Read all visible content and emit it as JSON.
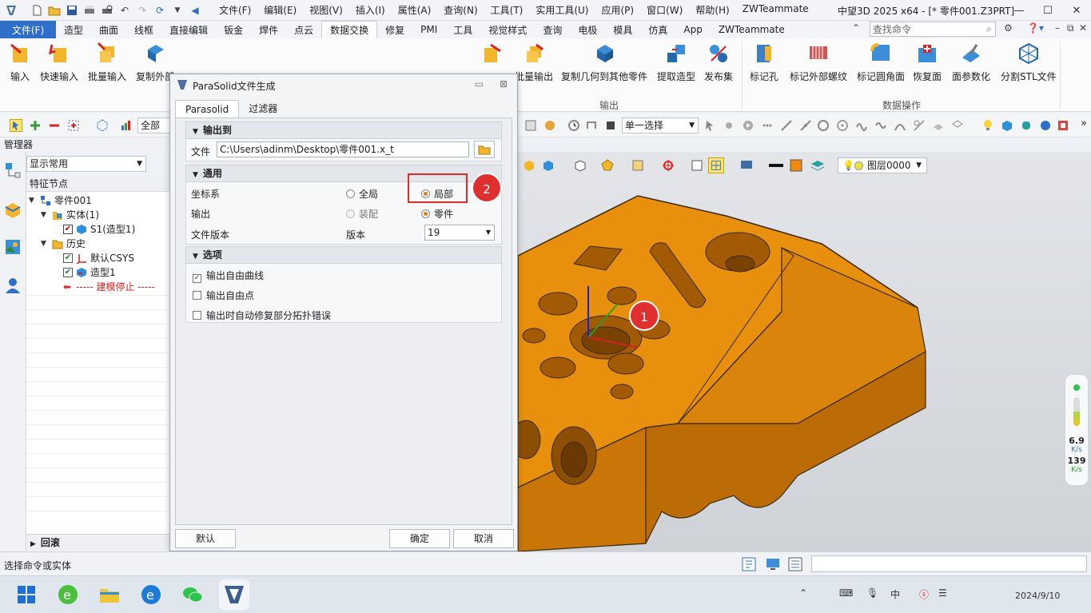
{
  "titlebar": {
    "menu": [
      "文件(F)",
      "编辑(E)",
      "视图(V)",
      "插入(I)",
      "属性(A)",
      "查询(N)",
      "工具(T)",
      "实用工具(U)",
      "应用(P)",
      "窗口(W)",
      "帮助(H)",
      "ZWTeammate"
    ],
    "app_title": "中望3D 2025 x64 - [* 零件001.Z3PRT]"
  },
  "tabs": {
    "file": "文件(F)",
    "items": [
      "造型",
      "曲面",
      "线框",
      "直接编辑",
      "钣金",
      "焊件",
      "点云",
      "数据交换",
      "修复",
      "PMI",
      "工具",
      "视觉样式",
      "查询",
      "电极",
      "模具",
      "仿真",
      "App",
      "ZWTeammate"
    ],
    "active": "数据交换",
    "search_placeholder": "查找命令"
  },
  "ribbon": {
    "buttons_left": [
      {
        "label": "输入",
        "icon": "import-icon"
      },
      {
        "label": "快速输入",
        "icon": "quick-import-icon"
      },
      {
        "label": "批量输入",
        "icon": "batch-import-icon"
      },
      {
        "label": "复制外部",
        "icon": "copy-external-icon"
      }
    ],
    "buttons_output": [
      {
        "label": "批量输出",
        "icon": "batch-export-icon"
      },
      {
        "label": "复制几何到其他零件",
        "icon": "copy-geometry-icon"
      },
      {
        "label": "提取造型",
        "icon": "extract-shape-icon"
      },
      {
        "label": "发布集",
        "icon": "publish-set-icon"
      }
    ],
    "buttons_data": [
      {
        "label": "标记孔",
        "icon": "mark-hole-icon"
      },
      {
        "label": "标记外部螺纹",
        "icon": "mark-thread-icon"
      },
      {
        "label": "标记圆角面",
        "icon": "mark-fillet-icon"
      },
      {
        "label": "恢复面",
        "icon": "restore-face-icon"
      },
      {
        "label": "面参数化",
        "icon": "face-param-icon"
      },
      {
        "label": "分割STL文件",
        "icon": "split-stl-icon"
      }
    ],
    "group_output": "输出",
    "group_data": "数据操作"
  },
  "toolbar2": {
    "filter": "全部",
    "select_mode": "单一选择"
  },
  "manager": {
    "title": "管理器",
    "combo": "显示常用",
    "tree_header": "特征节点",
    "tree": [
      {
        "label": "零件001",
        "level": 0
      },
      {
        "label": "实体(1)",
        "level": 1
      },
      {
        "label": "S1(造型1)",
        "level": 2
      },
      {
        "label": "历史",
        "level": 1
      },
      {
        "label": "默认CSYS",
        "level": 2
      },
      {
        "label": "造型1",
        "level": 2
      },
      {
        "label": "----- 建模停止 -----",
        "level": 2
      }
    ],
    "rollback": "回滚"
  },
  "viewport": {
    "layer": "图层0000"
  },
  "dialog": {
    "title": "ParaSolid文件生成",
    "tabs": [
      "Parasolid",
      "过滤器"
    ],
    "section_output": "输出到",
    "file_label": "文件",
    "file_value": "C:\\Users\\adinm\\Desktop\\零件001.x_t",
    "section_general": "通用",
    "coord_label": "坐标系",
    "coord_global": "全局",
    "coord_local": "局部",
    "output_label": "输出",
    "output_assembly": "装配",
    "output_part": "零件",
    "version_label": "文件版本",
    "version_label2": "版本",
    "version_value": "19",
    "section_options": "选项",
    "opt1": "输出自由曲线",
    "opt2": "输出自由点",
    "opt3": "输出时自动修复部分拓扑错误",
    "btn_default": "默认",
    "btn_ok": "确定",
    "btn_cancel": "取消"
  },
  "annotations": {
    "badge1": "1",
    "badge2": "2"
  },
  "status": {
    "text": "选择命令或实体"
  },
  "perf": {
    "v1": "6.9",
    "u1": "K/s",
    "v2": "139",
    "u2": "K/s"
  },
  "taskbar": {
    "clock": "2024/9/10"
  },
  "colors": {
    "accent": "#2f6fc9",
    "part": "#e08a0c",
    "highlight": "#e02a2a"
  }
}
